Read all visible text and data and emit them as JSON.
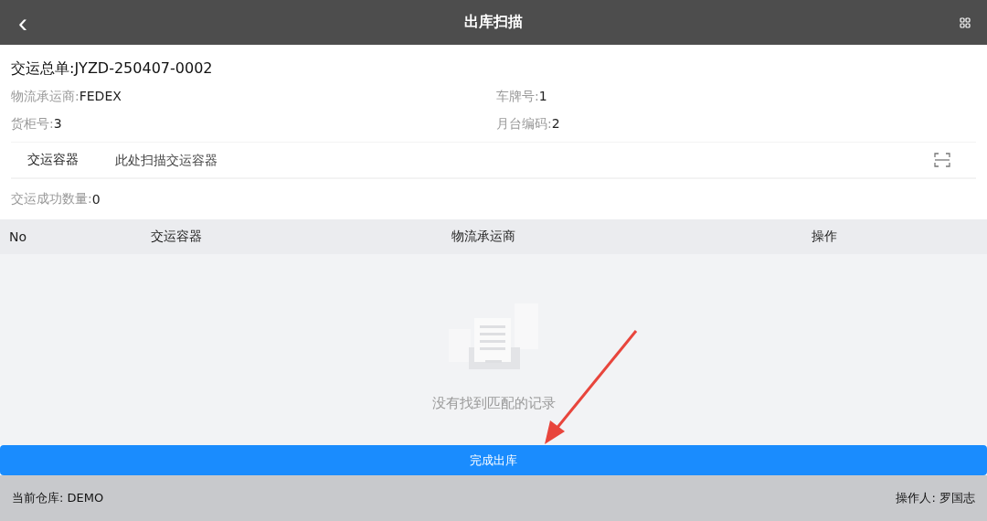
{
  "header": {
    "back": "‹",
    "title": "出库扫描"
  },
  "order": {
    "label": "交运总单:",
    "value": "JYZD-250407-0002"
  },
  "fields": [
    {
      "label": "物流承运商:",
      "value": "FEDEX"
    },
    {
      "label": "车牌号:",
      "value": "1"
    },
    {
      "label": "货柜号:",
      "value": "3"
    },
    {
      "label": "月台编码:",
      "value": "2"
    }
  ],
  "scan": {
    "label": "交运容器",
    "placeholder": "此处扫描交运容器"
  },
  "count": {
    "label": "交运成功数量:",
    "value": "0"
  },
  "table": {
    "columns": [
      "No",
      "交运容器",
      "物流承运商",
      "操作"
    ],
    "empty_text": "没有找到匹配的记录"
  },
  "button": "完成出库",
  "status_bar": {
    "warehouse": "当前仓库: DEMO",
    "operator": "操作人: 罗国志"
  }
}
